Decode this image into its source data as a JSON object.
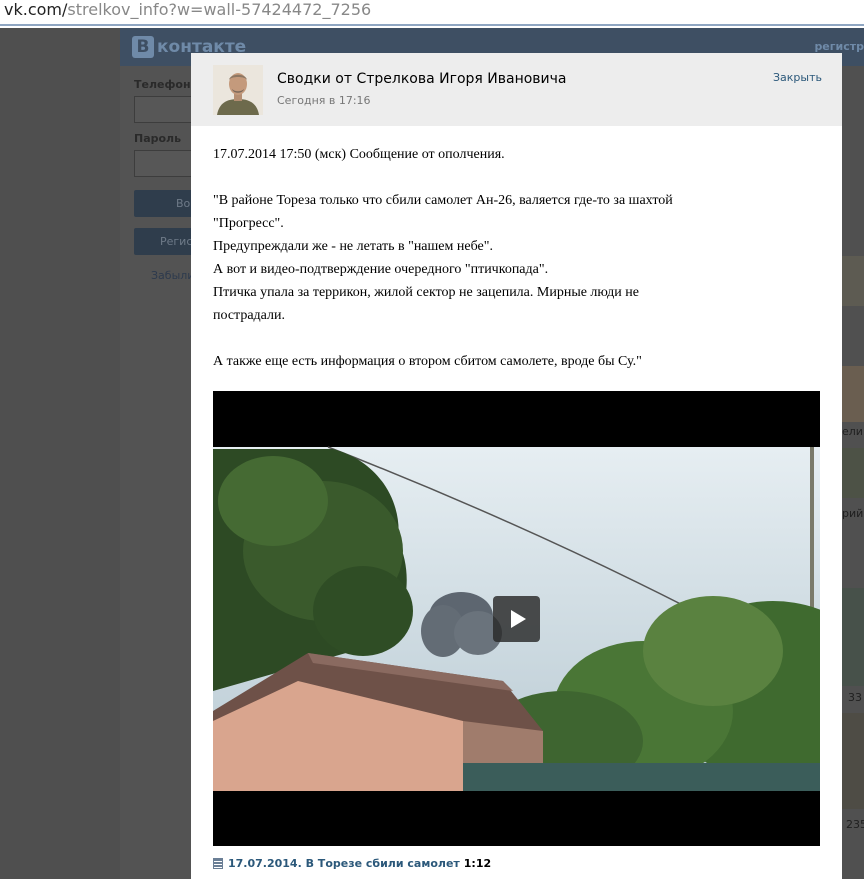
{
  "browser": {
    "url_host": "vk.com/",
    "url_rest": "strelkov_info?w=wall-57424472_7256"
  },
  "background_page": {
    "logo_text": "контакте",
    "logo_letter": "В",
    "header_right": "регистр",
    "phone_label": "Телефон",
    "password_label": "Пароль",
    "login_button": "Во",
    "register_button": "Регис",
    "forgot_link": "Забыли",
    "right_snippets": [
      "елин",
      "рий",
      "33",
      "235"
    ]
  },
  "post": {
    "title": "Сводки от Стрелкова Игоря Ивановича",
    "date": "Сегодня в 17:16",
    "close_label": "Закрыть",
    "lines": [
      "17.07.2014 17:50 (мск) Сообщение от ополчения.",
      "",
      "\"В районе Тореза только что сбили самолет Ан-26, валяется где-то за шахтой",
      "\"Прогресс\".",
      "Предупреждали же - не летать в \"нашем небе\".",
      "А вот и видео-подтверждение очередного \"птичкопада\".",
      "Птичка упала за террикон, жилой сектор не зацепила. Мирные люди не",
      "пострадали.",
      "",
      "А также еще есть информация о втором сбитом самолете, вроде бы Су.\""
    ],
    "video": {
      "title": "17.07.2014. В Торезе сбили самолет",
      "duration": "1:12"
    }
  },
  "colors": {
    "link": "#2b587a",
    "overlay": "#4f4f4f",
    "header_bg": "#ededed"
  }
}
